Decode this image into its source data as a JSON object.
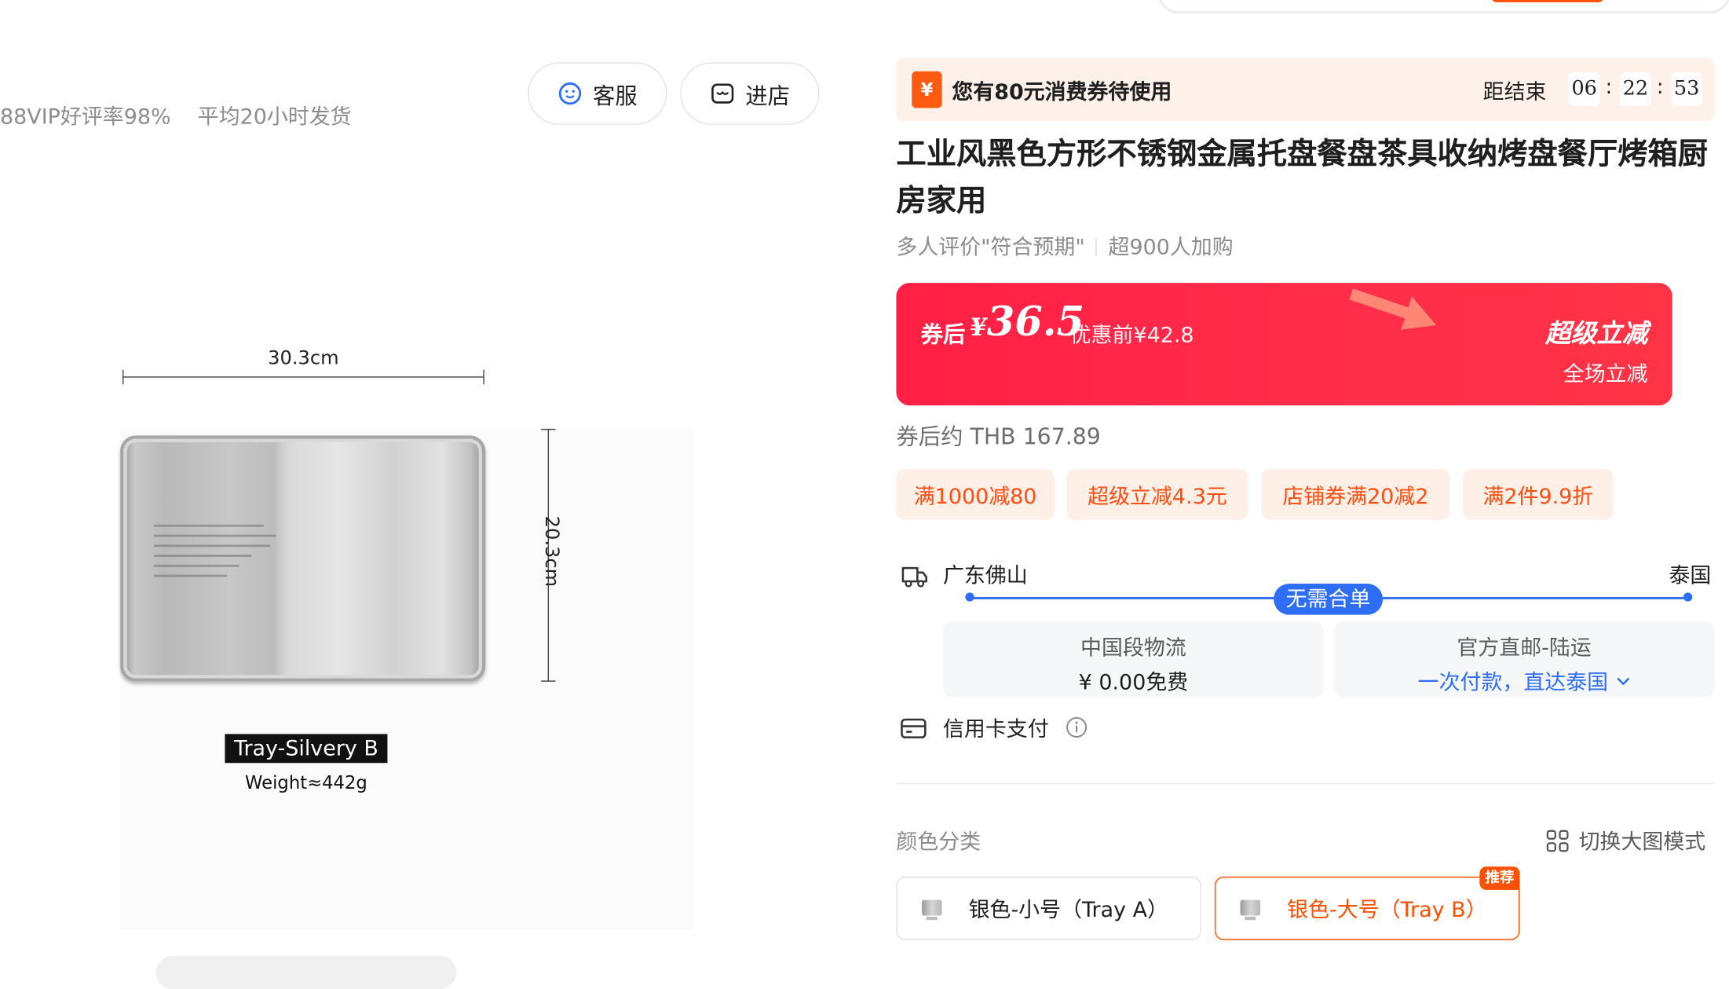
{
  "store": {
    "stats": [
      "88VIP好评率98%",
      "平均20小时发货"
    ],
    "service_label": "客服",
    "enter_store_label": "进店"
  },
  "product_image": {
    "width_label": "30.3cm",
    "height_label": "20.3cm",
    "variant_label": "Tray-Silvery B",
    "weight_label": "Weight≈442g"
  },
  "coupon_banner": {
    "text": "您有80元消费券待使用",
    "icon_text": "¥",
    "countdown_label": "距结束",
    "hours": "06",
    "minutes": "22",
    "seconds": "53",
    "separator": ":"
  },
  "product": {
    "title": "工业风黑色方形不锈钢金属托盘餐盘茶具收纳烤盘餐厅烤箱厨房家用",
    "review_highlight": "多人评价\"符合预期\"",
    "cart_count": "超900人加购"
  },
  "price": {
    "after_coupon_label": "券后",
    "currency": "¥",
    "amount": "36.5",
    "original_label": "优惠前¥42.8",
    "promo_title": "超级立减",
    "promo_subtitle": "全场立减",
    "converted": "券后约 THB 167.89"
  },
  "promo_tags": [
    "满1000减80",
    "超级立减4.3元",
    "店铺券满20减2",
    "满2件9.9折"
  ],
  "shipping": {
    "from": "广东佛山",
    "to": "泰国",
    "badge": "无需合单",
    "segment1_name": "中国段物流",
    "segment1_price": "¥ 0.00免费",
    "segment2_name": "官方直邮-陆运",
    "segment2_desc": "一次付款，直达泰国"
  },
  "payment": {
    "label": "信用卡支付"
  },
  "sku": {
    "section_title": "颜色分类",
    "switch_mode_label": "切换大图模式",
    "options": [
      {
        "label": "银色-小号（Tray A）",
        "selected": false
      },
      {
        "label": "银色-大号（Tray B）",
        "selected": true,
        "badge": "推荐"
      }
    ]
  },
  "colors": {
    "accent": "#ff5000",
    "price_red": "#ff2d4a",
    "link_blue": "#2e6ef5",
    "tag_bg": "#fef0e7",
    "tag_text": "#ff4d12"
  }
}
